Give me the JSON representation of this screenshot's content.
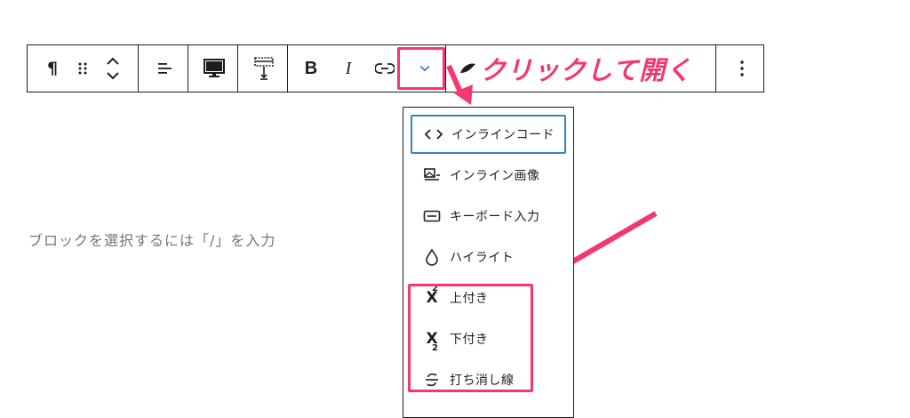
{
  "toolbar": {
    "paragraph_glyph": "¶",
    "bold_label": "B",
    "italic_label": "I"
  },
  "callout": {
    "text": "クリックして開く"
  },
  "editor": {
    "placeholder": "ブロックを選択するには「/」を入力"
  },
  "dropdown": {
    "items": [
      {
        "label": "インラインコード",
        "icon": "code-icon"
      },
      {
        "label": "インライン画像",
        "icon": "inline-image-icon"
      },
      {
        "label": "キーボード入力",
        "icon": "keyboard-icon"
      },
      {
        "label": "ハイライト",
        "icon": "droplet-icon"
      },
      {
        "label": "上付き",
        "icon": "superscript-icon"
      },
      {
        "label": "下付き",
        "icon": "subscript-icon"
      },
      {
        "label": "打ち消し線",
        "icon": "strikethrough-icon"
      }
    ]
  },
  "colors": {
    "accent": "#f4376e",
    "focus": "#3582c4",
    "text": "#1e1e1e",
    "placeholder": "#757575"
  }
}
